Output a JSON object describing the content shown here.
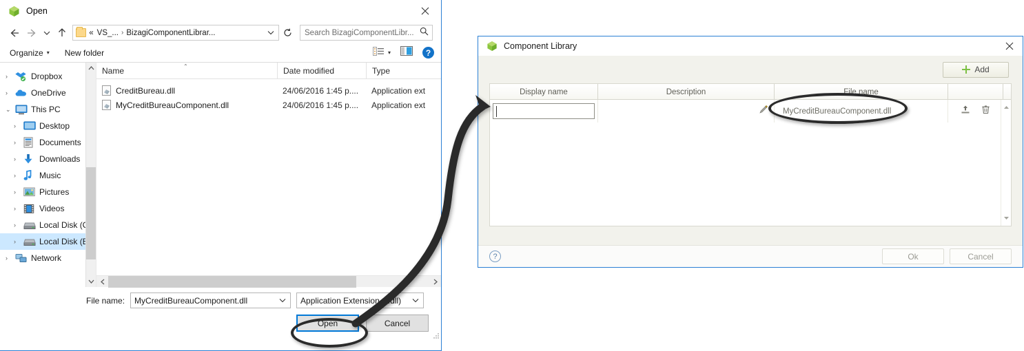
{
  "open_dialog": {
    "title": "Open",
    "title_icon": "bizagi-green-cube-icon",
    "close_label": "✕",
    "nav": {
      "back_icon": "arrow-left-icon",
      "forward_icon": "arrow-right-icon",
      "recent_icon": "chevron-down-icon",
      "up_icon": "arrow-up-icon",
      "breadcrumb_prefix": "«",
      "breadcrumb_1": "VS_...",
      "breadcrumb_sep": "›",
      "breadcrumb_2": "BizagiComponentLibrar...",
      "address_dropdown_icon": "chevron-down-icon",
      "refresh_icon": "refresh-icon",
      "search_placeholder": "Search BizagiComponentLibr...",
      "search_icon": "magnifier-icon"
    },
    "toolbar": {
      "organize": "Organize",
      "organize_caret": "▾",
      "new_folder": "New folder",
      "view_icon": "list-view-icon",
      "view_caret": "▾",
      "pane_icon": "preview-pane-icon",
      "help_label": "?"
    },
    "tree": [
      {
        "label": "Dropbox",
        "icon": "dropbox-icon",
        "indent": 0,
        "expander": "›",
        "selected": false
      },
      {
        "label": "OneDrive",
        "icon": "onedrive-cloud-icon",
        "indent": 0,
        "expander": "›",
        "selected": false
      },
      {
        "label": "This PC",
        "icon": "computer-icon",
        "indent": 0,
        "expander": "⌄",
        "selected": false
      },
      {
        "label": "Desktop",
        "icon": "desktop-icon",
        "indent": 1,
        "expander": "›",
        "selected": false
      },
      {
        "label": "Documents",
        "icon": "documents-icon",
        "indent": 1,
        "expander": "›",
        "selected": false
      },
      {
        "label": "Downloads",
        "icon": "downloads-arrow-icon",
        "indent": 1,
        "expander": "›",
        "selected": false
      },
      {
        "label": "Music",
        "icon": "music-note-icon",
        "indent": 1,
        "expander": "›",
        "selected": false
      },
      {
        "label": "Pictures",
        "icon": "pictures-icon",
        "indent": 1,
        "expander": "›",
        "selected": false
      },
      {
        "label": "Videos",
        "icon": "videos-icon",
        "indent": 1,
        "expander": "›",
        "selected": false
      },
      {
        "label": "Local Disk (C:)",
        "icon": "hard-drive-icon",
        "indent": 1,
        "expander": "›",
        "selected": false
      },
      {
        "label": "Local Disk (E:)",
        "icon": "hard-drive-icon",
        "indent": 1,
        "expander": "›",
        "selected": true
      },
      {
        "label": "Network",
        "icon": "network-icon",
        "indent": 0,
        "expander": "›",
        "selected": false
      }
    ],
    "list": {
      "columns": [
        "Name",
        "Date modified",
        "Type"
      ],
      "sort_indicator": "⌃",
      "rows": [
        {
          "name": "CreditBureau.dll",
          "date": "24/06/2016 1:45 p....",
          "type": "Application ext",
          "icon": "dll-file-icon"
        },
        {
          "name": "MyCreditBureauComponent.dll",
          "date": "24/06/2016 1:45 p....",
          "type": "Application ext",
          "icon": "dll-file-icon"
        }
      ]
    },
    "footer": {
      "file_name_label": "File name:",
      "file_name_value": "MyCreditBureauComponent.dll",
      "filter_value": "Application Extension (*.dll)",
      "open_button": "Open",
      "cancel_button": "Cancel"
    }
  },
  "component_library": {
    "title": "Component Library",
    "title_icon": "bizagi-green-cube-icon",
    "close_label": "✕",
    "add_button": "Add",
    "add_icon": "plus-icon",
    "grid": {
      "columns": [
        "Display name",
        "Description",
        "File name"
      ],
      "rows": [
        {
          "display_name": "",
          "description": "",
          "file_name": "MyCreditBureauComponent.dll",
          "edit_icon": "pencil-icon",
          "upload_icon": "upload-icon",
          "delete_icon": "trash-icon"
        }
      ],
      "scroll_up_icon": "triangle-up-icon",
      "scroll_down_icon": "triangle-down-icon"
    },
    "footer": {
      "help_label": "?",
      "ok_button": "Ok",
      "cancel_button": "Cancel"
    }
  },
  "annotations": {
    "arrow": "curved-arrow-from-open-button-to-file-name-cell",
    "highlight_open_button": "ellipse-highlight",
    "highlight_file_name_cell": "ellipse-highlight"
  },
  "colors": {
    "window_border": "#2a7fd4",
    "selection": "#cce8ff",
    "focus_button": "#0078d7",
    "accent_green": "#7cc043",
    "annotation": "#2b2b2b"
  }
}
